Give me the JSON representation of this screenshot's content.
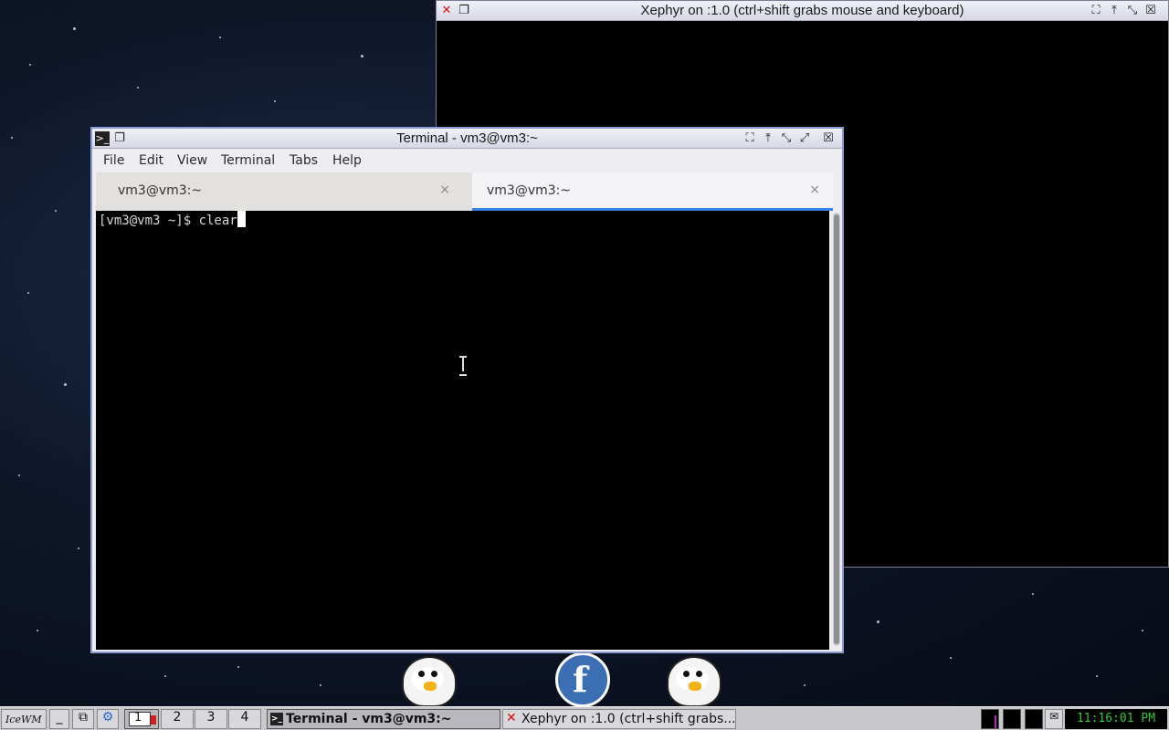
{
  "xephyr": {
    "title": "Xephyr on :1.0 (ctrl+shift grabs mouse and keyboard)"
  },
  "terminal": {
    "title": "Terminal - vm3@vm3:~",
    "menu": [
      "File",
      "Edit",
      "View",
      "Terminal",
      "Tabs",
      "Help"
    ],
    "tabs": [
      {
        "label": "vm3@vm3:~",
        "close": "×",
        "active": false
      },
      {
        "label": "vm3@vm3:~",
        "close": "×",
        "active": true
      }
    ],
    "prompt": "[vm3@vm3 ~]$ ",
    "command": "clear"
  },
  "taskbar": {
    "logo": "IceWM",
    "workspaces": [
      "1",
      "2",
      "3",
      "4"
    ],
    "tasks": [
      {
        "label": "Terminal - vm3@vm3:~",
        "active": true
      },
      {
        "label": "Xephyr on :1.0 (ctrl+shift grabs...",
        "active": false
      }
    ],
    "clock": "11:16:01 PM"
  },
  "colors": {
    "accent_tab": "#3584e4",
    "clock_text": "#3cc43c",
    "terminal_bg": "#000000"
  }
}
